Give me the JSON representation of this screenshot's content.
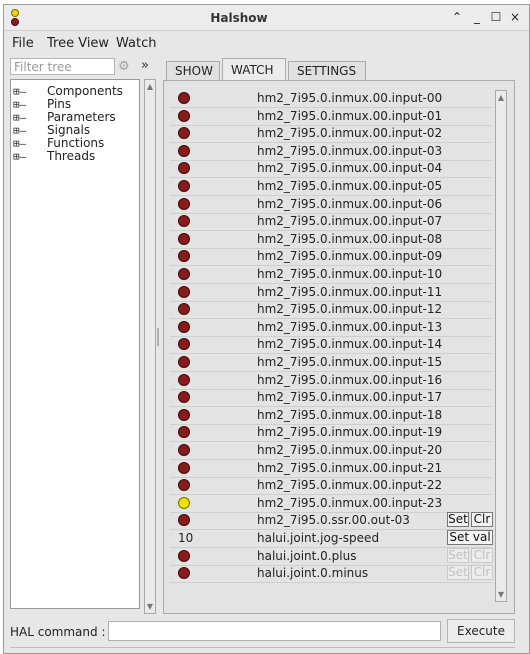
{
  "window": {
    "title": "Halshow",
    "controls": {
      "collapse": "⌃",
      "minimize": "_",
      "maximize": "☐",
      "close": "×"
    }
  },
  "menubar": {
    "items": [
      "File",
      "Tree View",
      "Watch"
    ]
  },
  "sidebar": {
    "filter_placeholder": "Filter tree",
    "filter_value": "",
    "expand_symbol": "»",
    "tree": [
      {
        "expander": "⊞—",
        "label": "Components"
      },
      {
        "expander": "⊞—",
        "label": "Pins"
      },
      {
        "expander": "⊞—",
        "label": "Parameters"
      },
      {
        "expander": "⊞—",
        "label": "Signals"
      },
      {
        "expander": "⊞—",
        "label": "Functions"
      },
      {
        "expander": "⊞—",
        "label": "Threads"
      }
    ]
  },
  "tabs": [
    {
      "label": "SHOW",
      "active": false
    },
    {
      "label": "WATCH",
      "active": true
    },
    {
      "label": "SETTINGS",
      "active": false
    }
  ],
  "watch": {
    "colors": {
      "led_off": "#8b1a1a",
      "led_on": "#f0e000"
    },
    "rows": [
      {
        "kind": "led",
        "state": "off",
        "label": "hm2_7i95.0.inmux.00.input-00"
      },
      {
        "kind": "led",
        "state": "off",
        "label": "hm2_7i95.0.inmux.00.input-01"
      },
      {
        "kind": "led",
        "state": "off",
        "label": "hm2_7i95.0.inmux.00.input-02"
      },
      {
        "kind": "led",
        "state": "off",
        "label": "hm2_7i95.0.inmux.00.input-03"
      },
      {
        "kind": "led",
        "state": "off",
        "label": "hm2_7i95.0.inmux.00.input-04"
      },
      {
        "kind": "led",
        "state": "off",
        "label": "hm2_7i95.0.inmux.00.input-05"
      },
      {
        "kind": "led",
        "state": "off",
        "label": "hm2_7i95.0.inmux.00.input-06"
      },
      {
        "kind": "led",
        "state": "off",
        "label": "hm2_7i95.0.inmux.00.input-07"
      },
      {
        "kind": "led",
        "state": "off",
        "label": "hm2_7i95.0.inmux.00.input-08"
      },
      {
        "kind": "led",
        "state": "off",
        "label": "hm2_7i95.0.inmux.00.input-09"
      },
      {
        "kind": "led",
        "state": "off",
        "label": "hm2_7i95.0.inmux.00.input-10"
      },
      {
        "kind": "led",
        "state": "off",
        "label": "hm2_7i95.0.inmux.00.input-11"
      },
      {
        "kind": "led",
        "state": "off",
        "label": "hm2_7i95.0.inmux.00.input-12"
      },
      {
        "kind": "led",
        "state": "off",
        "label": "hm2_7i95.0.inmux.00.input-13"
      },
      {
        "kind": "led",
        "state": "off",
        "label": "hm2_7i95.0.inmux.00.input-14"
      },
      {
        "kind": "led",
        "state": "off",
        "label": "hm2_7i95.0.inmux.00.input-15"
      },
      {
        "kind": "led",
        "state": "off",
        "label": "hm2_7i95.0.inmux.00.input-16"
      },
      {
        "kind": "led",
        "state": "off",
        "label": "hm2_7i95.0.inmux.00.input-17"
      },
      {
        "kind": "led",
        "state": "off",
        "label": "hm2_7i95.0.inmux.00.input-18"
      },
      {
        "kind": "led",
        "state": "off",
        "label": "hm2_7i95.0.inmux.00.input-19"
      },
      {
        "kind": "led",
        "state": "off",
        "label": "hm2_7i95.0.inmux.00.input-20"
      },
      {
        "kind": "led",
        "state": "off",
        "label": "hm2_7i95.0.inmux.00.input-21"
      },
      {
        "kind": "led",
        "state": "off",
        "label": "hm2_7i95.0.inmux.00.input-22"
      },
      {
        "kind": "led",
        "state": "on",
        "label": "hm2_7i95.0.inmux.00.input-23"
      },
      {
        "kind": "led",
        "state": "off",
        "label": "hm2_7i95.0.ssr.00.out-03",
        "buttons": [
          {
            "label": "Set",
            "disabled": false
          },
          {
            "label": "Clr",
            "disabled": false
          }
        ]
      },
      {
        "kind": "value",
        "value": "10",
        "label": "halui.joint.jog-speed",
        "buttons": [
          {
            "label": "Set val",
            "disabled": false
          }
        ]
      },
      {
        "kind": "led",
        "state": "off",
        "label": "halui.joint.0.plus",
        "buttons": [
          {
            "label": "Set",
            "disabled": true
          },
          {
            "label": "Clr",
            "disabled": true
          }
        ]
      },
      {
        "kind": "led",
        "state": "off",
        "label": "halui.joint.0.minus",
        "buttons": [
          {
            "label": "Set",
            "disabled": true
          },
          {
            "label": "Clr",
            "disabled": true
          }
        ]
      }
    ]
  },
  "footer": {
    "hal_label": "HAL command :",
    "hal_value": "",
    "execute_label": "Execute"
  }
}
